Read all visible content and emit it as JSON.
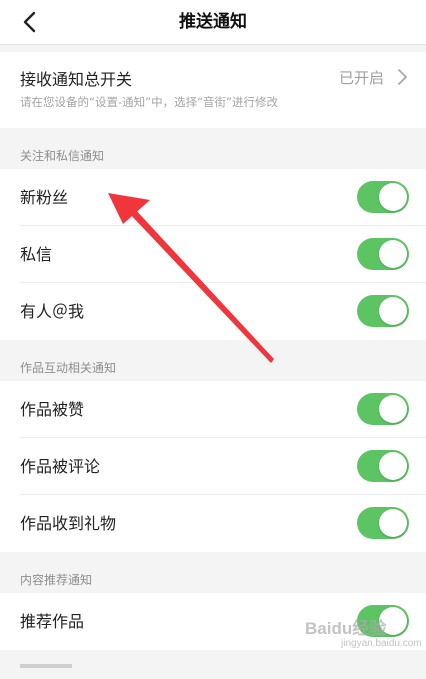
{
  "navbar": {
    "title": "推送通知",
    "back_icon": "back-arrow-icon"
  },
  "master_switch": {
    "title": "接收通知总开关",
    "status": "已开启",
    "description": "请在您设备的“设置-通知”中，选择“音街”进行修改",
    "chevron_icon": "chevron-right-icon"
  },
  "sections": [
    {
      "header": "关注和私信通知",
      "items": [
        {
          "label": "新粉丝",
          "enabled": true
        },
        {
          "label": "私信",
          "enabled": true
        },
        {
          "label": "有人＠我",
          "enabled": true
        }
      ]
    },
    {
      "header": "作品互动相关通知",
      "items": [
        {
          "label": "作品被赞",
          "enabled": true
        },
        {
          "label": "作品被评论",
          "enabled": true
        },
        {
          "label": "作品收到礼物",
          "enabled": true
        }
      ]
    },
    {
      "header": "内容推荐通知",
      "items": [
        {
          "label": "推荐作品",
          "enabled": true
        }
      ]
    }
  ],
  "colors": {
    "toggle_on": "#5dc464",
    "annotation_arrow": "#f0363c",
    "background": "#f4f4f4"
  },
  "watermark": {
    "text": "Baidu经验",
    "sub": "jingyan.baidu.com"
  }
}
